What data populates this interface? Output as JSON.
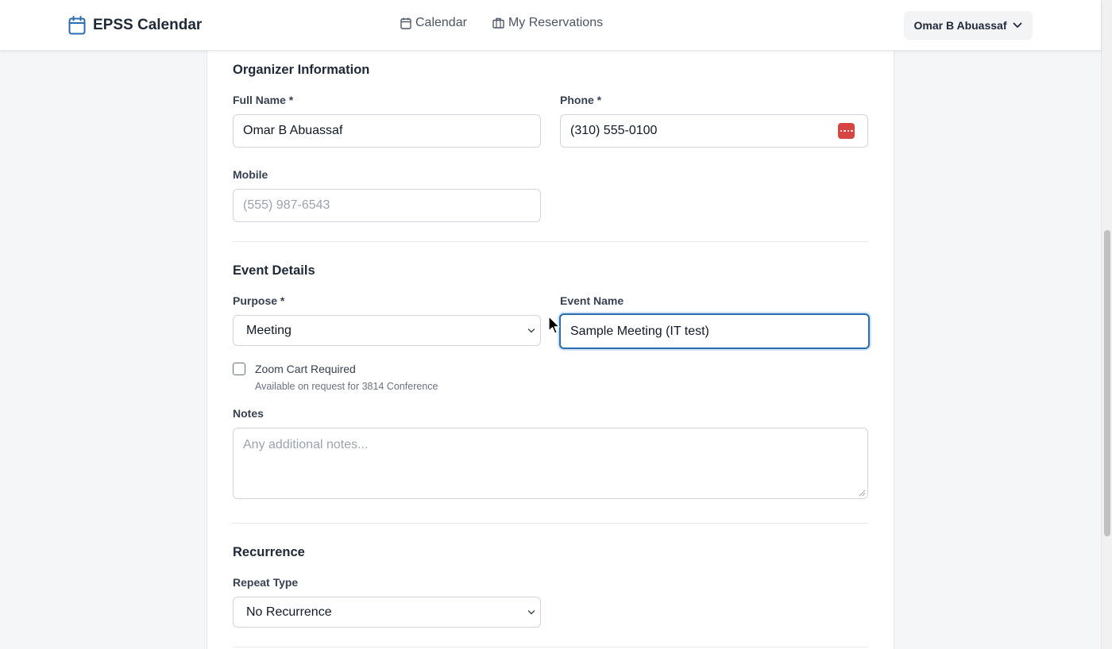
{
  "header": {
    "app_title": "EPSS Calendar",
    "brand_icon": "calendar-icon",
    "nav": [
      {
        "label": "Calendar",
        "icon": "calendar-icon"
      },
      {
        "label": "My Reservations",
        "icon": "briefcase-icon"
      }
    ],
    "user_name": "Omar B Abuassaf"
  },
  "organizer": {
    "section_title": "Organizer Information",
    "full_name_label": "Full Name *",
    "full_name_value": "Omar B Abuassaf",
    "phone_label": "Phone *",
    "phone_value": "(310) 555-0100",
    "mobile_label": "Mobile",
    "mobile_placeholder": "(555) 987-6543"
  },
  "event": {
    "section_title": "Event Details",
    "purpose_label": "Purpose *",
    "purpose_value": "Meeting",
    "event_name_label": "Event Name",
    "event_name_value": "Sample Meeting (IT test)",
    "zoom_label": "Zoom Cart Required",
    "zoom_hint": "Available on request for 3814 Conference",
    "zoom_checked": false,
    "notes_label": "Notes",
    "notes_placeholder": "Any additional notes..."
  },
  "recurrence": {
    "section_title": "Recurrence",
    "repeat_label": "Repeat Type",
    "repeat_value": "No Recurrence"
  },
  "colors": {
    "accent": "#2b6cb0",
    "brand_icon": "#2b6cb0",
    "password_icon": "#d64541"
  }
}
